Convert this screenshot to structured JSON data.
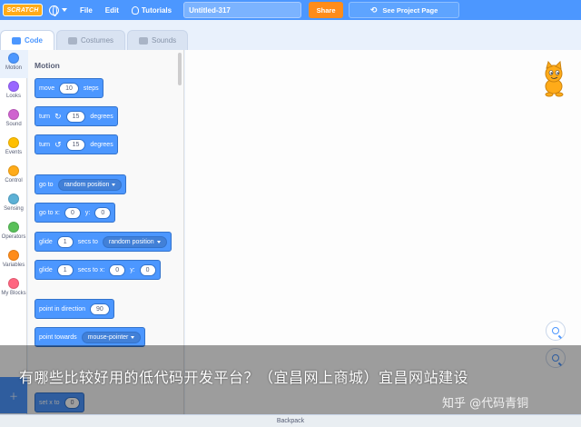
{
  "menubar": {
    "logo_text": "SCRATCH",
    "file_label": "File",
    "edit_label": "Edit",
    "tutorials_label": "Tutorials",
    "project_title": "Untitled-317",
    "share_label": "Share",
    "see_project_label": "See Project Page"
  },
  "tabs": [
    {
      "label": "Code",
      "active": true
    },
    {
      "label": "Costumes",
      "active": false
    },
    {
      "label": "Sounds",
      "active": false
    }
  ],
  "categories": [
    {
      "label": "Motion",
      "color": "#4c97ff"
    },
    {
      "label": "Looks",
      "color": "#9966ff"
    },
    {
      "label": "Sound",
      "color": "#cf63cf"
    },
    {
      "label": "Events",
      "color": "#ffbf00"
    },
    {
      "label": "Control",
      "color": "#ffab19"
    },
    {
      "label": "Sensing",
      "color": "#5cb1d6"
    },
    {
      "label": "Operators",
      "color": "#59c059"
    },
    {
      "label": "Variables",
      "color": "#ff8c1a"
    },
    {
      "label": "My Blocks",
      "color": "#ff6680"
    }
  ],
  "palette": {
    "section_title": "Motion",
    "blocks": {
      "move": {
        "pre": "move",
        "val": "10",
        "post": "steps"
      },
      "turn_cw": {
        "pre": "turn",
        "icon": "↻",
        "val": "15",
        "post": "degrees"
      },
      "turn_ccw": {
        "pre": "turn",
        "icon": "↺",
        "val": "15",
        "post": "degrees"
      },
      "goto": {
        "pre": "go to",
        "menu": "random position"
      },
      "goto_xy": {
        "pre": "go to x:",
        "x": "0",
        "ylabel": "y:",
        "y": "0"
      },
      "glide_to": {
        "pre": "glide",
        "val": "1",
        "mid": "secs to",
        "menu": "random position"
      },
      "glide_xy": {
        "pre": "glide",
        "val": "1",
        "mid": "secs to x:",
        "x": "0",
        "ylabel": "y:",
        "y": "0"
      },
      "point_dir": {
        "pre": "point in direction",
        "val": "90"
      },
      "point_towards": {
        "pre": "point towards",
        "menu": "mouse-pointer"
      },
      "set_x": {
        "pre": "set x to",
        "val": "0"
      }
    }
  },
  "backpack_label": "Backpack",
  "overlay": {
    "caption": "有哪些比较好用的低代码开发平台？（宜昌网上商城）宜昌网站建设",
    "watermark": "知乎 @代码青铜"
  }
}
